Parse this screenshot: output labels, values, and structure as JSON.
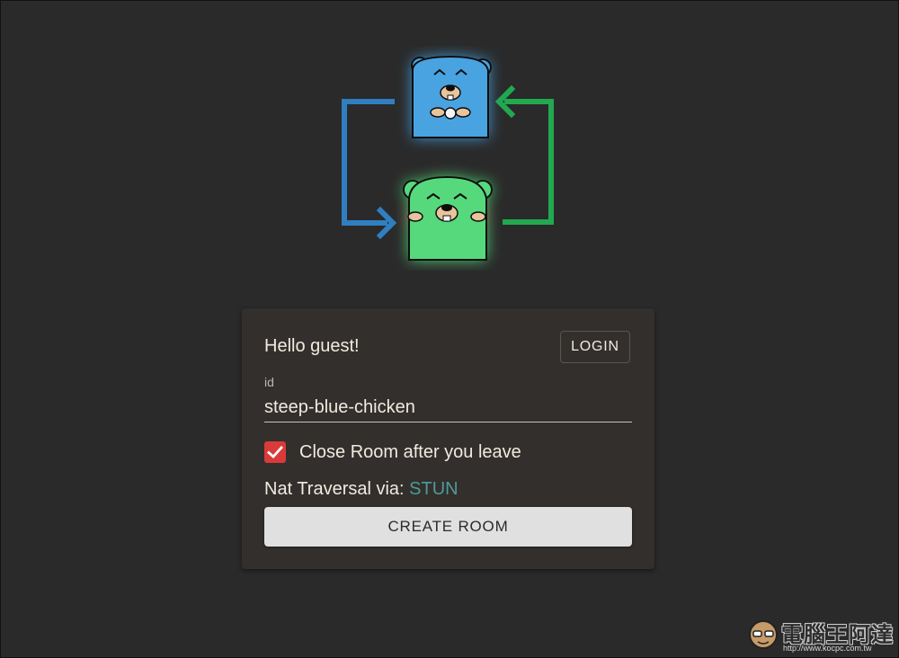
{
  "logo": {
    "top_gopher": "blue-gopher-icon",
    "bottom_gopher": "green-gopher-icon",
    "colors": {
      "blue": "#4aa3e0",
      "green": "#56d97c",
      "blue_arrow": "#2f7fc1",
      "green_arrow": "#22a84f"
    }
  },
  "card": {
    "greeting": "Hello guest!",
    "login_label": "LOGIN",
    "id_label": "id",
    "id_value": "steep-blue-chicken",
    "close_room_checked": true,
    "close_room_label": "Close Room after you leave",
    "nat_prefix": "Nat Traversal via: ",
    "nat_value": "STUN",
    "create_label": "CREATE ROOM"
  },
  "watermark": {
    "text": "電腦王阿達",
    "url": "http://www.kocpc.com.tw"
  },
  "colors": {
    "background": "#2a2a2a",
    "card": "#322f2d",
    "checkbox": "#d93a3a",
    "accent_link": "#4f9a9a"
  }
}
